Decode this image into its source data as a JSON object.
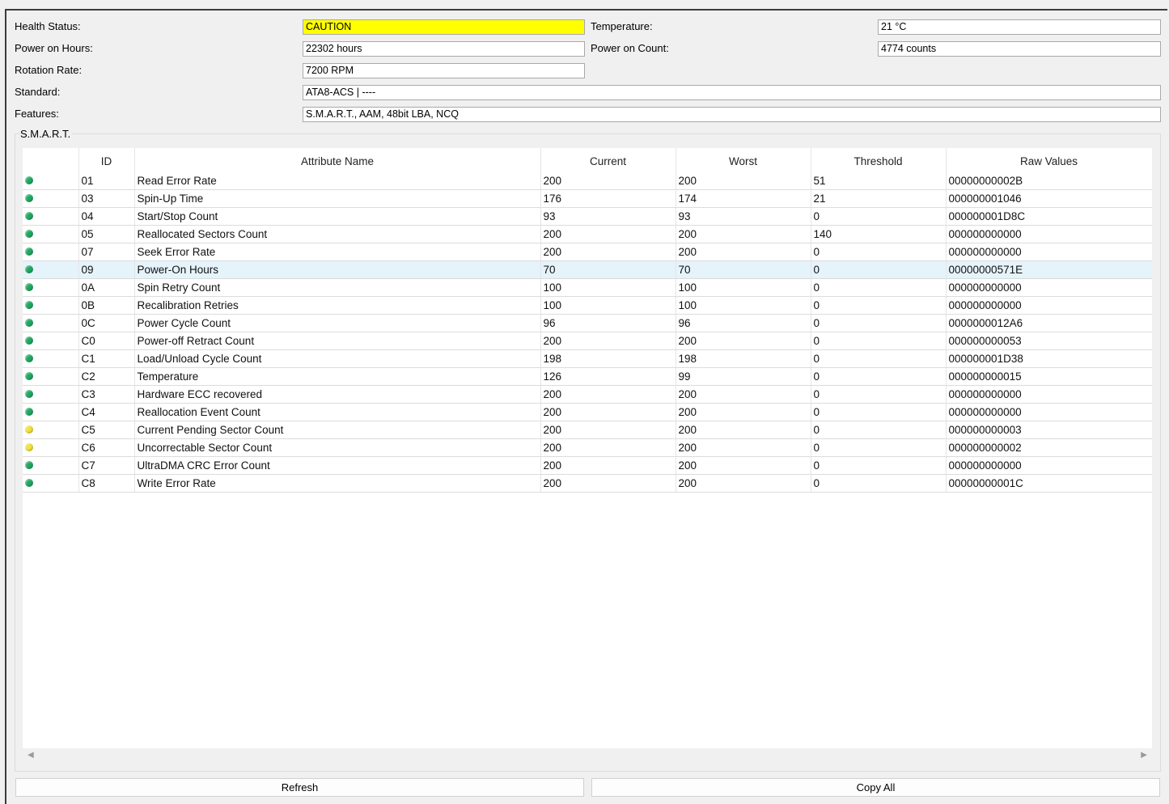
{
  "info": {
    "health_label": "Health Status:",
    "health_value": "CAUTION",
    "temperature_label": "Temperature:",
    "temperature_value": "21 °C",
    "power_hours_label": "Power on Hours:",
    "power_hours_value": "22302 hours",
    "power_count_label": "Power on Count:",
    "power_count_value": "4774 counts",
    "rotation_label": "Rotation Rate:",
    "rotation_value": "7200 RPM",
    "standard_label": "Standard:",
    "standard_value": "ATA8-ACS | ----",
    "features_label": "Features:",
    "features_value": "S.M.A.R.T., AAM, 48bit LBA, NCQ"
  },
  "smart": {
    "group_title": "S.M.A.R.T.",
    "columns": [
      "",
      "ID",
      "Attribute Name",
      "Current",
      "Worst",
      "Threshold",
      "Raw Values"
    ],
    "rows": [
      {
        "status": "good",
        "id": "01",
        "name": "Read Error Rate",
        "current": "200",
        "worst": "200",
        "threshold": "51",
        "raw": "00000000002B"
      },
      {
        "status": "good",
        "id": "03",
        "name": "Spin-Up Time",
        "current": "176",
        "worst": "174",
        "threshold": "21",
        "raw": "000000001046"
      },
      {
        "status": "good",
        "id": "04",
        "name": "Start/Stop Count",
        "current": "93",
        "worst": "93",
        "threshold": "0",
        "raw": "000000001D8C"
      },
      {
        "status": "good",
        "id": "05",
        "name": "Reallocated Sectors Count",
        "current": "200",
        "worst": "200",
        "threshold": "140",
        "raw": "000000000000"
      },
      {
        "status": "good",
        "id": "07",
        "name": "Seek Error Rate",
        "current": "200",
        "worst": "200",
        "threshold": "0",
        "raw": "000000000000"
      },
      {
        "status": "good",
        "id": "09",
        "name": "Power-On Hours",
        "current": "70",
        "worst": "70",
        "threshold": "0",
        "raw": "00000000571E",
        "selected": true
      },
      {
        "status": "good",
        "id": "0A",
        "name": "Spin Retry Count",
        "current": "100",
        "worst": "100",
        "threshold": "0",
        "raw": "000000000000"
      },
      {
        "status": "good",
        "id": "0B",
        "name": "Recalibration Retries",
        "current": "100",
        "worst": "100",
        "threshold": "0",
        "raw": "000000000000"
      },
      {
        "status": "good",
        "id": "0C",
        "name": "Power Cycle Count",
        "current": "96",
        "worst": "96",
        "threshold": "0",
        "raw": "0000000012A6"
      },
      {
        "status": "good",
        "id": "C0",
        "name": "Power-off Retract Count",
        "current": "200",
        "worst": "200",
        "threshold": "0",
        "raw": "000000000053"
      },
      {
        "status": "good",
        "id": "C1",
        "name": "Load/Unload Cycle Count",
        "current": "198",
        "worst": "198",
        "threshold": "0",
        "raw": "000000001D38"
      },
      {
        "status": "good",
        "id": "C2",
        "name": "Temperature",
        "current": "126",
        "worst": "99",
        "threshold": "0",
        "raw": "000000000015"
      },
      {
        "status": "good",
        "id": "C3",
        "name": "Hardware ECC recovered",
        "current": "200",
        "worst": "200",
        "threshold": "0",
        "raw": "000000000000"
      },
      {
        "status": "good",
        "id": "C4",
        "name": "Reallocation Event Count",
        "current": "200",
        "worst": "200",
        "threshold": "0",
        "raw": "000000000000"
      },
      {
        "status": "caution",
        "id": "C5",
        "name": "Current Pending Sector Count",
        "current": "200",
        "worst": "200",
        "threshold": "0",
        "raw": "000000000003"
      },
      {
        "status": "caution",
        "id": "C6",
        "name": "Uncorrectable Sector Count",
        "current": "200",
        "worst": "200",
        "threshold": "0",
        "raw": "000000000002"
      },
      {
        "status": "good",
        "id": "C7",
        "name": "UltraDMA CRC Error Count",
        "current": "200",
        "worst": "200",
        "threshold": "0",
        "raw": "000000000000"
      },
      {
        "status": "good",
        "id": "C8",
        "name": "Write Error Rate",
        "current": "200",
        "worst": "200",
        "threshold": "0",
        "raw": "00000000001C"
      }
    ]
  },
  "buttons": {
    "refresh": "Refresh",
    "copy_all": "Copy All"
  },
  "colors": {
    "good": "#1fa860",
    "caution": "#f2e23a",
    "caution_field": "#ffff00",
    "selection": "#e5f3fb"
  },
  "icons": {
    "scroll_left": "◀",
    "scroll_right": "▶"
  }
}
